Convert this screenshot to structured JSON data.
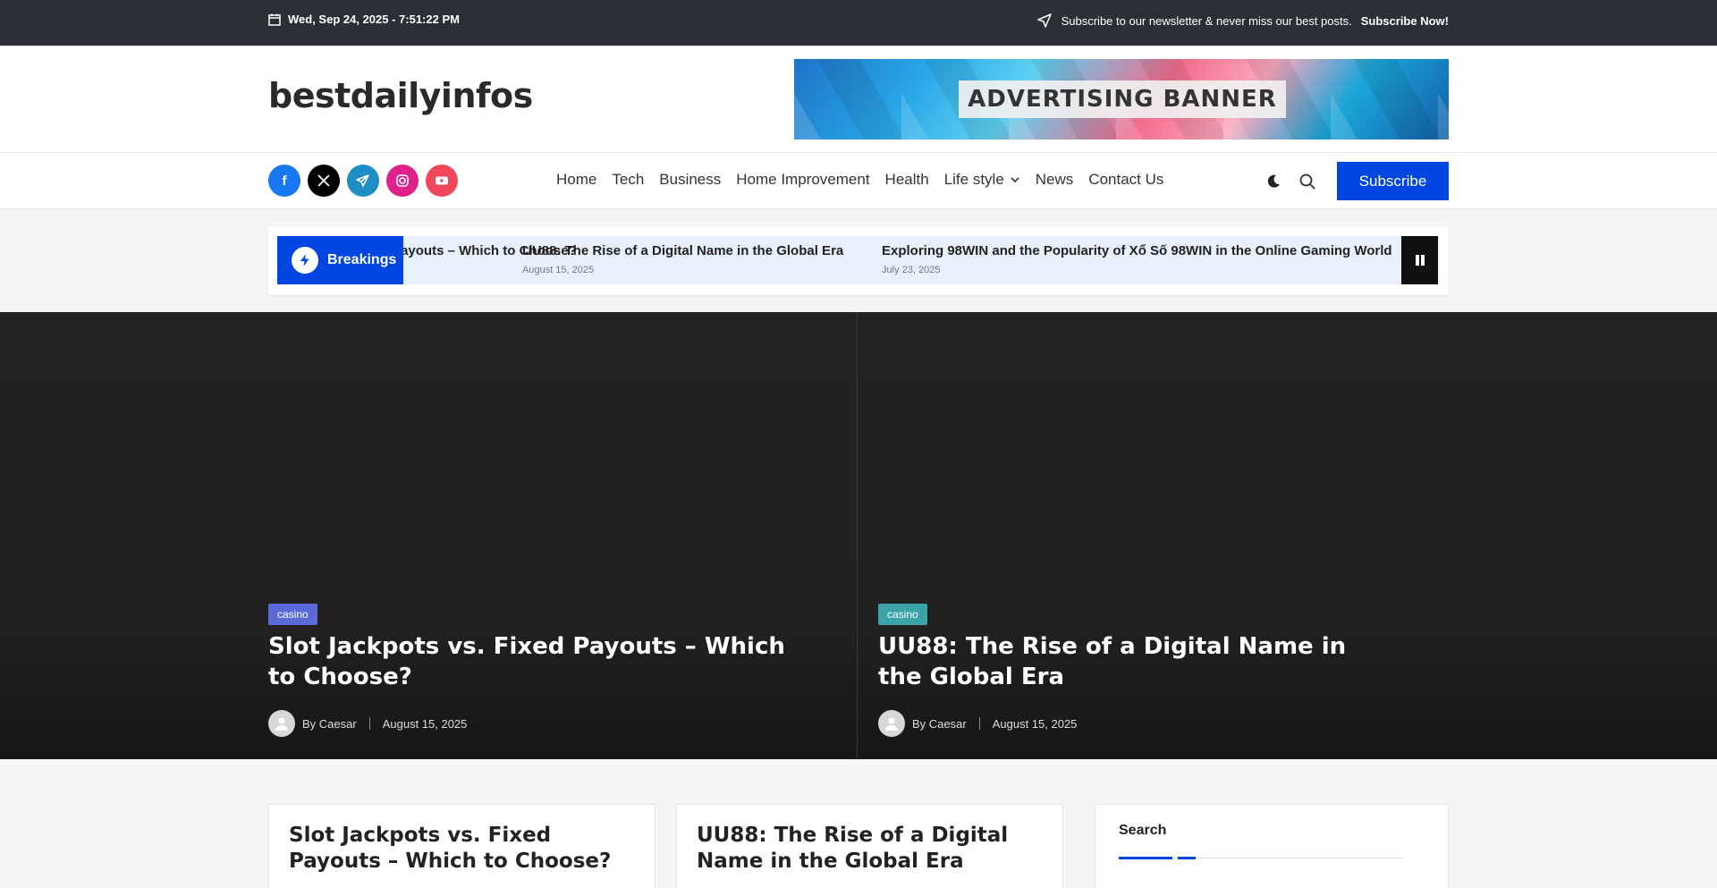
{
  "topbar": {
    "date": "Wed, Sep 24, 2025 - 7:51:22 PM",
    "newsletter_text": "Subscribe to our newsletter & never miss our best posts.",
    "newsletter_cta": "Subscribe Now!"
  },
  "header": {
    "logo": "bestdailyinfos",
    "ad_text": "ADVERTISING BANNER"
  },
  "nav": {
    "socials": [
      "facebook-icon",
      "x-icon",
      "telegram-icon",
      "instagram-icon",
      "youtube-icon"
    ],
    "items": [
      "Home",
      "Tech",
      "Business",
      "Home Improvement",
      "Health",
      "Life style",
      "News",
      "Contact Us"
    ],
    "subscribe_label": "Subscribe"
  },
  "ticker": {
    "label": "Breakings",
    "items": [
      {
        "title": "Slot Jackpots vs. Fixed Payouts – Which to Choose?",
        "date": ""
      },
      {
        "title": "UU88: The Rise of a Digital Name in the Global Era",
        "date": "August 15, 2025"
      },
      {
        "title": "Exploring 98WIN and the Popularity of Xổ Số 98WIN in the Online Gaming World",
        "date": "July 23, 2025"
      }
    ]
  },
  "hero": [
    {
      "category": "casino",
      "title": "Slot Jackpots vs. Fixed Payouts – Which to Choose?",
      "author": "By Caesar",
      "date": "August 15, 2025"
    },
    {
      "category": "casino",
      "title": "UU88: The Rise of a Digital Name in the Global Era",
      "author": "By Caesar",
      "date": "August 15, 2025"
    }
  ],
  "cards": [
    {
      "title": "Slot Jackpots vs. Fixed Payouts – Which to Choose?"
    },
    {
      "title": "UU88: The Rise of a Digital Name in the Global Era"
    }
  ],
  "sidebar": {
    "search_title": "Search"
  },
  "colors": {
    "topbar": "#2b2f36",
    "accent": "#0046e0",
    "ticker_bg": "#e8effd",
    "hero_bg": "#222222",
    "cat_left": "#5b6ad8",
    "cat_right": "#3aa3a8"
  }
}
